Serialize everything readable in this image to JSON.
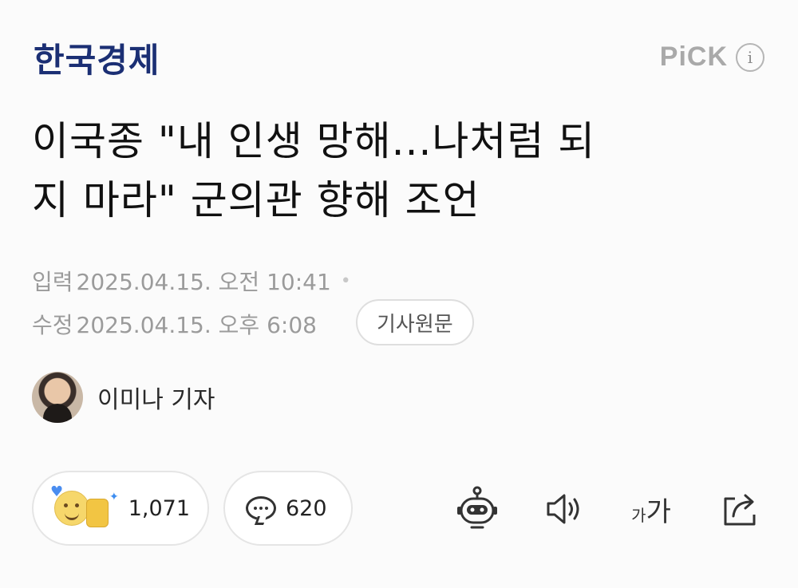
{
  "header": {
    "brand": "한국경제",
    "pick_label": "PiCK",
    "info_glyph": "i"
  },
  "article": {
    "title_line1": "이국종 \"내 인생 망해...나처럼 되",
    "title_line2": "지 마라\" 군의관 향해 조언",
    "published_label": "입력",
    "published": "2025.04.15. 오전 10:41",
    "modified_label": "수정",
    "modified": "2025.04.15. 오후 6:08",
    "source_button": "기사원문"
  },
  "reporter": {
    "name": "이미나 기자"
  },
  "actions": {
    "reaction_count": "1,071",
    "comment_count": "620",
    "font_small": "가",
    "font_big": "가"
  },
  "icons": [
    "info-icon",
    "reaction-emoji-icon",
    "comment-bubble-icon",
    "summary-bot-icon",
    "speaker-icon",
    "font-size-icon",
    "share-icon"
  ],
  "colors": {
    "brand": "#1b2f74",
    "muted": "#9b9b9b",
    "background": "#fbfbfb"
  }
}
